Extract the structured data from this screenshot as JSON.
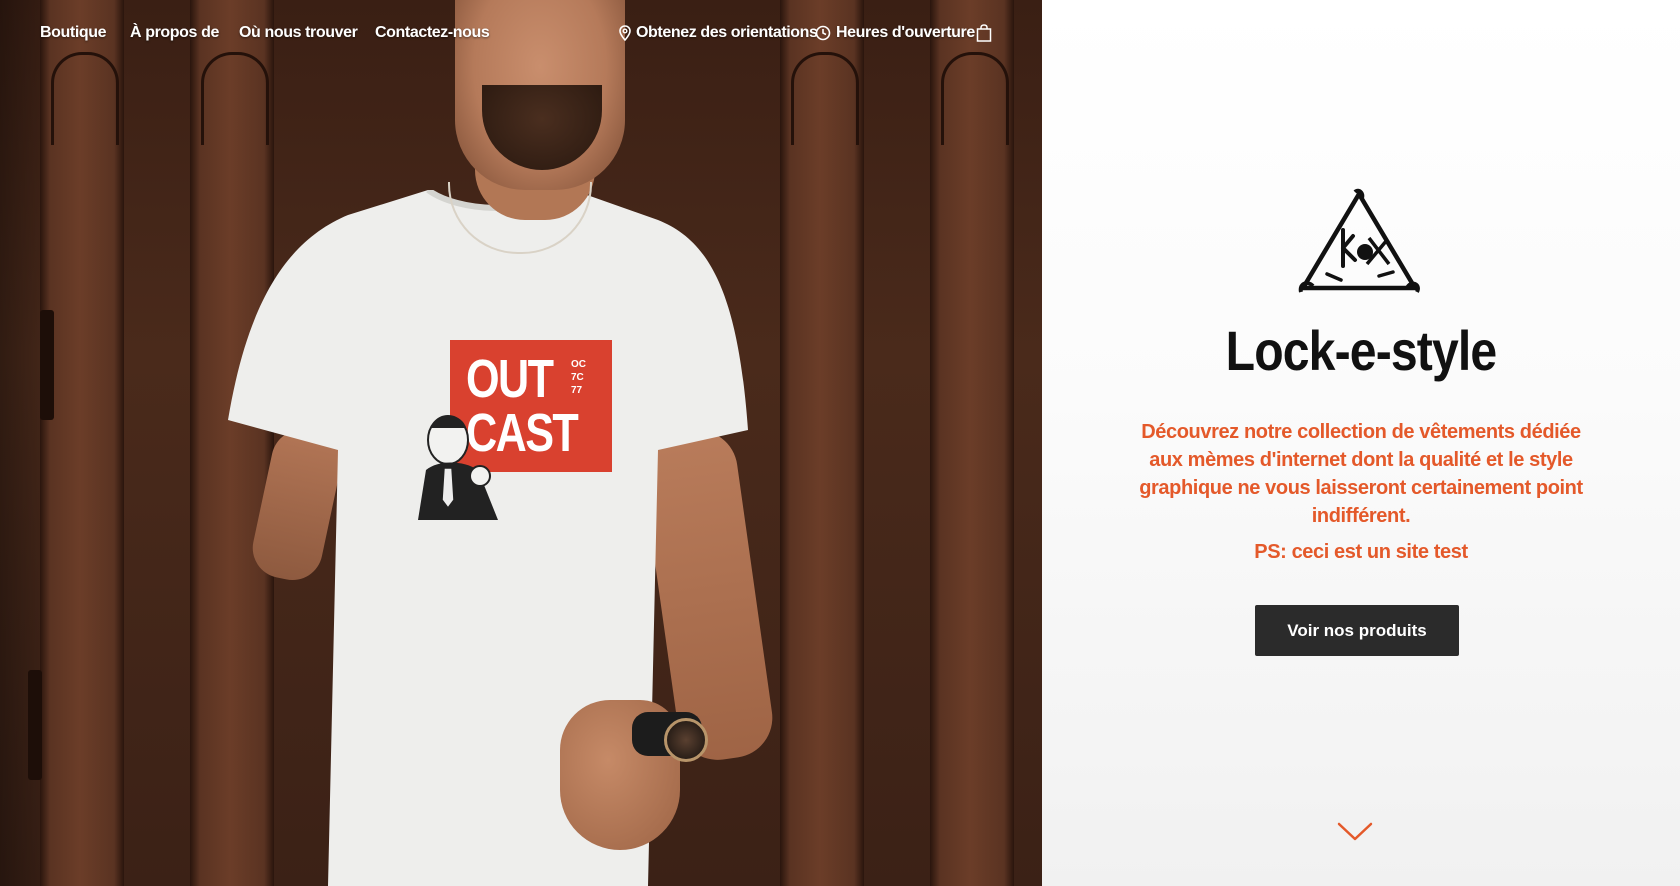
{
  "nav": {
    "items": [
      {
        "label": "Boutique"
      },
      {
        "label": "À propos de"
      },
      {
        "label": "Où nous trouver"
      },
      {
        "label": "Contactez-nous"
      }
    ],
    "directions_label": "Obtenez des orientations",
    "hours_label": "Heures d'ouverture",
    "cart_icon": "shopping-bag-icon"
  },
  "hero": {
    "shirt_print": {
      "line1": "OUT",
      "line2": "CAST",
      "side_text": [
        "OC",
        "7C",
        "77"
      ]
    }
  },
  "main": {
    "brand_name": "Lock-e-style",
    "description": "Découvrez notre collection de vêtements dédiée aux mèmes d'internet dont la qualité et le style graphique ne vous laisseront certainement point indifférent.",
    "ps_note": "PS: ceci est un site test",
    "cta_label": "Voir nos produits",
    "scroll_icon": "chevron-down-icon"
  },
  "colors": {
    "accent": "#e4592a",
    "button_bg": "#2b2b2b",
    "title": "#111111"
  }
}
